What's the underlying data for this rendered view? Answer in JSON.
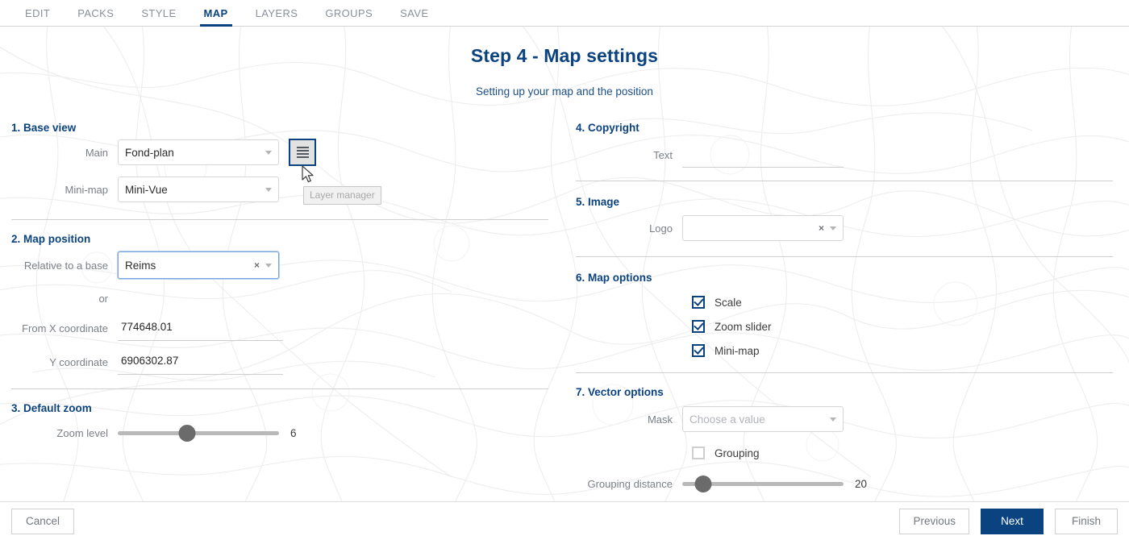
{
  "tabs": [
    {
      "label": "EDIT",
      "active": false
    },
    {
      "label": "PACKS",
      "active": false
    },
    {
      "label": "STYLE",
      "active": false
    },
    {
      "label": "MAP",
      "active": true
    },
    {
      "label": "LAYERS",
      "active": false
    },
    {
      "label": "GROUPS",
      "active": false
    },
    {
      "label": "SAVE",
      "active": false
    }
  ],
  "header": {
    "title": "Step 4 - Map settings",
    "subtitle": "Setting up your map and the position"
  },
  "sections": {
    "base_view": {
      "title": "1. Base view",
      "main_label": "Main",
      "main_value": "Fond-plan",
      "minimap_label": "Mini-map",
      "minimap_value": "Mini-Vue",
      "layer_manager_tooltip": "Layer manager"
    },
    "map_position": {
      "title": "2. Map position",
      "relative_label": "Relative to a base",
      "relative_value": "Reims",
      "or_label": "or",
      "x_label": "From X coordinate",
      "x_value": "774648.01",
      "y_label": "Y coordinate",
      "y_value": "6906302.87"
    },
    "default_zoom": {
      "title": "3. Default zoom",
      "zoom_label": "Zoom level",
      "zoom_value": "6",
      "zoom_percent": 43
    },
    "copyright": {
      "title": "4. Copyright",
      "text_label": "Text",
      "text_value": "",
      "text_placeholder": ""
    },
    "image": {
      "title": "5. Image",
      "logo_label": "Logo",
      "logo_value": "",
      "logo_clear": "×"
    },
    "map_options": {
      "title": "6. Map options",
      "options": [
        {
          "label": "Scale",
          "checked": true
        },
        {
          "label": "Zoom slider",
          "checked": true
        },
        {
          "label": "Mini-map",
          "checked": true
        }
      ]
    },
    "vector_options": {
      "title": "7. Vector options",
      "mask_label": "Mask",
      "mask_placeholder": "Choose a value",
      "grouping_label": "Grouping",
      "grouping_checked": false,
      "distance_label": "Grouping distance",
      "distance_value": "20",
      "distance_percent": 13
    }
  },
  "footer": {
    "cancel": "Cancel",
    "previous": "Previous",
    "next": "Next",
    "finish": "Finish"
  },
  "colors": {
    "accent": "#0b4380",
    "label_gray": "#7a7f87",
    "slider_track": "#b9b9b9",
    "slider_thumb": "#6b6b6b"
  }
}
